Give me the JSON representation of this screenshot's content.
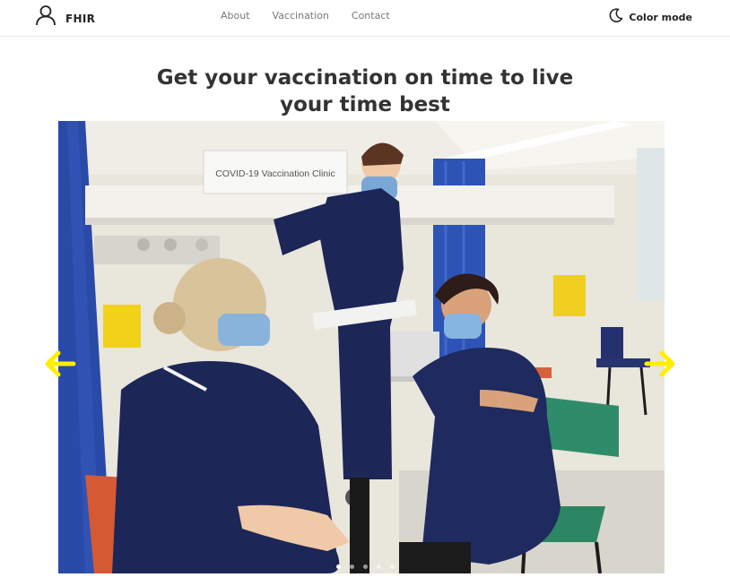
{
  "nav": {
    "brand": "FHIR",
    "links": [
      "About",
      "Vaccination",
      "Contact"
    ],
    "color_mode_label": "Color mode"
  },
  "hero": {
    "title_line1": "Get your vaccination on time to live",
    "title_line2": "your time best"
  },
  "carousel": {
    "slide_sign_text": "COVID-19 Vaccination Clinic",
    "slide_count": 5,
    "active_slide": 1,
    "arrow_color": "#ffee00"
  },
  "colors": {
    "uniform": "#1c2657",
    "curtain": "#2a4aa8",
    "wall": "#ece8dc"
  }
}
